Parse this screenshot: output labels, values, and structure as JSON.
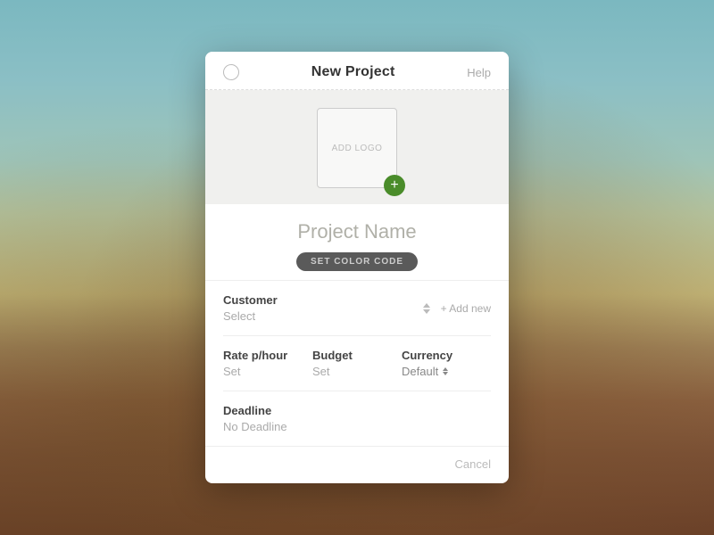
{
  "background": {
    "description": "Mountain landscape background"
  },
  "modal": {
    "title": "New Project",
    "help_label": "Help",
    "logo_placeholder": "ADD LOGO",
    "project_name_placeholder": "Project Name",
    "color_code_button": "SET COLOR CODE",
    "customer": {
      "label": "Customer",
      "value": "Select",
      "add_new": "+ Add new"
    },
    "rate": {
      "label": "Rate p/hour",
      "value": "Set"
    },
    "budget": {
      "label": "Budget",
      "value": "Set"
    },
    "currency": {
      "label": "Currency",
      "value": "Default"
    },
    "deadline": {
      "label": "Deadline",
      "value": "No Deadline"
    },
    "cancel_button": "Cancel"
  }
}
